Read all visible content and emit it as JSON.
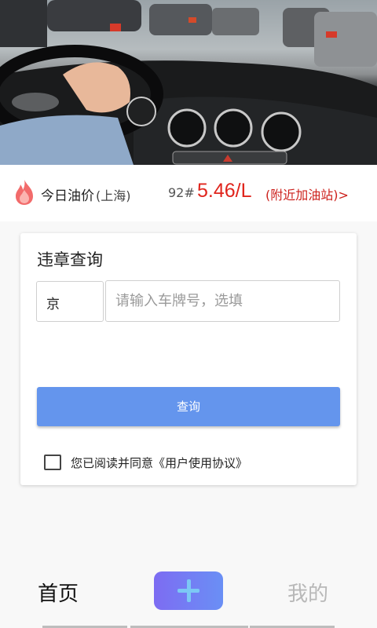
{
  "fuel": {
    "label": "今日油价",
    "city": "(上海)",
    "grade": "92#",
    "price": "5.46/L",
    "station_link": "(附近加油站)>",
    "flame_icon": "flame-icon",
    "accent_color": "#e0251d"
  },
  "violation": {
    "title": "违章查询",
    "province": "京",
    "plate_placeholder": "请输入车牌号，选填",
    "plate_value": "",
    "query_label": "查询",
    "agreement_text": "您已阅读并同意《用户使用协议》",
    "agreement_checked": false,
    "button_color": "#6495ed"
  },
  "nav": {
    "home_label": "首页",
    "add_icon": "plus-icon",
    "mine_label": "我的"
  }
}
